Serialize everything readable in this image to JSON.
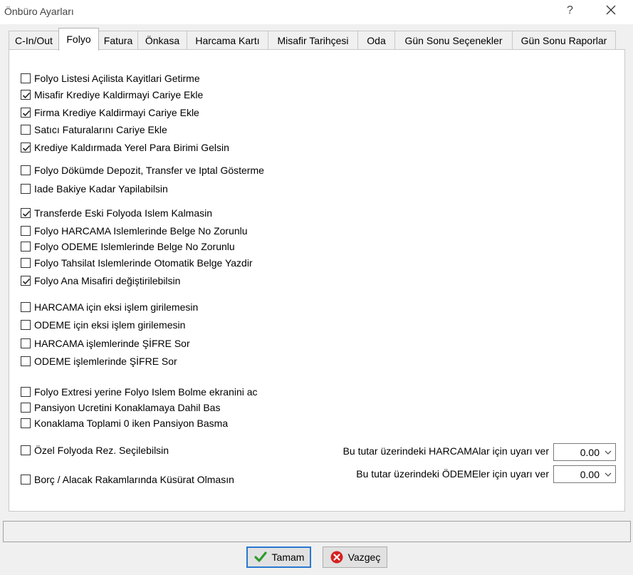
{
  "window": {
    "title": "Önbüro Ayarları",
    "help_glyph": "?"
  },
  "tabs": [
    {
      "label": "C-In/Out",
      "active": false
    },
    {
      "label": "Folyo",
      "active": true
    },
    {
      "label": "Fatura",
      "active": false
    },
    {
      "label": "Önkasa",
      "active": false
    },
    {
      "label": "Harcama Kartı",
      "active": false
    },
    {
      "label": "Misafir Tarihçesi",
      "active": false
    },
    {
      "label": "Oda",
      "active": false
    },
    {
      "label": "Gün Sonu Seçenekler",
      "active": false
    },
    {
      "label": "Gün Sonu Raporlar",
      "active": false
    }
  ],
  "options": [
    {
      "label": "Folyo Listesi Açilista Kayitlari Getirme",
      "checked": false
    },
    {
      "label": "Misafir Krediye Kaldirmayi Cariye Ekle",
      "checked": true
    },
    {
      "label": "Firma Krediye Kaldirmayi Cariye Ekle",
      "checked": true
    },
    {
      "label": "Satıcı Faturalarını Cariye Ekle",
      "checked": false
    },
    {
      "label": "Krediye Kaldırmada Yerel Para Birimi Gelsin",
      "checked": true
    },
    {
      "label": "Folyo Dökümde Depozit, Transfer ve Iptal Gösterme",
      "checked": false
    },
    {
      "label": "Iade Bakiye Kadar Yapilabilsin",
      "checked": false
    },
    {
      "label": "Transferde Eski Folyoda Islem Kalmasin",
      "checked": true
    },
    {
      "label": "Folyo HARCAMA Islemlerinde Belge No Zorunlu",
      "checked": false
    },
    {
      "label": "Folyo ODEME Islemlerinde Belge No Zorunlu",
      "checked": false
    },
    {
      "label": "Folyo Tahsilat Islemlerinde Otomatik Belge Yazdir",
      "checked": false
    },
    {
      "label": "Folyo Ana Misafiri değiştirilebilsin",
      "checked": true
    },
    {
      "label": "HARCAMA için eksi işlem girilemesin",
      "checked": false
    },
    {
      "label": "ODEME için eksi işlem girilemesin",
      "checked": false
    },
    {
      "label": "HARCAMA işlemlerinde ŞİFRE Sor",
      "checked": false
    },
    {
      "label": "ODEME işlemlerinde ŞİFRE Sor",
      "checked": false
    },
    {
      "label": "Folyo Extresi yerine Folyo Islem Bolme ekranini ac",
      "checked": false
    },
    {
      "label": "Pansiyon Ucretini Konaklamaya Dahil Bas",
      "checked": false
    },
    {
      "label": "Konaklama Toplami 0 iken Pansiyon Basma",
      "checked": false
    },
    {
      "label": "Özel Folyoda Rez. Seçilebilsin",
      "checked": false
    },
    {
      "label": "Borç / Alacak Rakamlarında Küsürat Olmasın",
      "checked": false
    }
  ],
  "warnings": [
    {
      "label": "Bu tutar üzerindeki HARCAMAlar için uyarı ver",
      "value": "0.00"
    },
    {
      "label": "Bu tutar üzerindeki ÖDEMEler için uyarı ver",
      "value": "0.00"
    }
  ],
  "buttons": {
    "ok_label": "Tamam",
    "cancel_label": "Vazgeç"
  },
  "colors": {
    "ok_icon": "#2c9a2c",
    "cancel_icon": "#d62020",
    "focus_border": "#2878d0"
  }
}
